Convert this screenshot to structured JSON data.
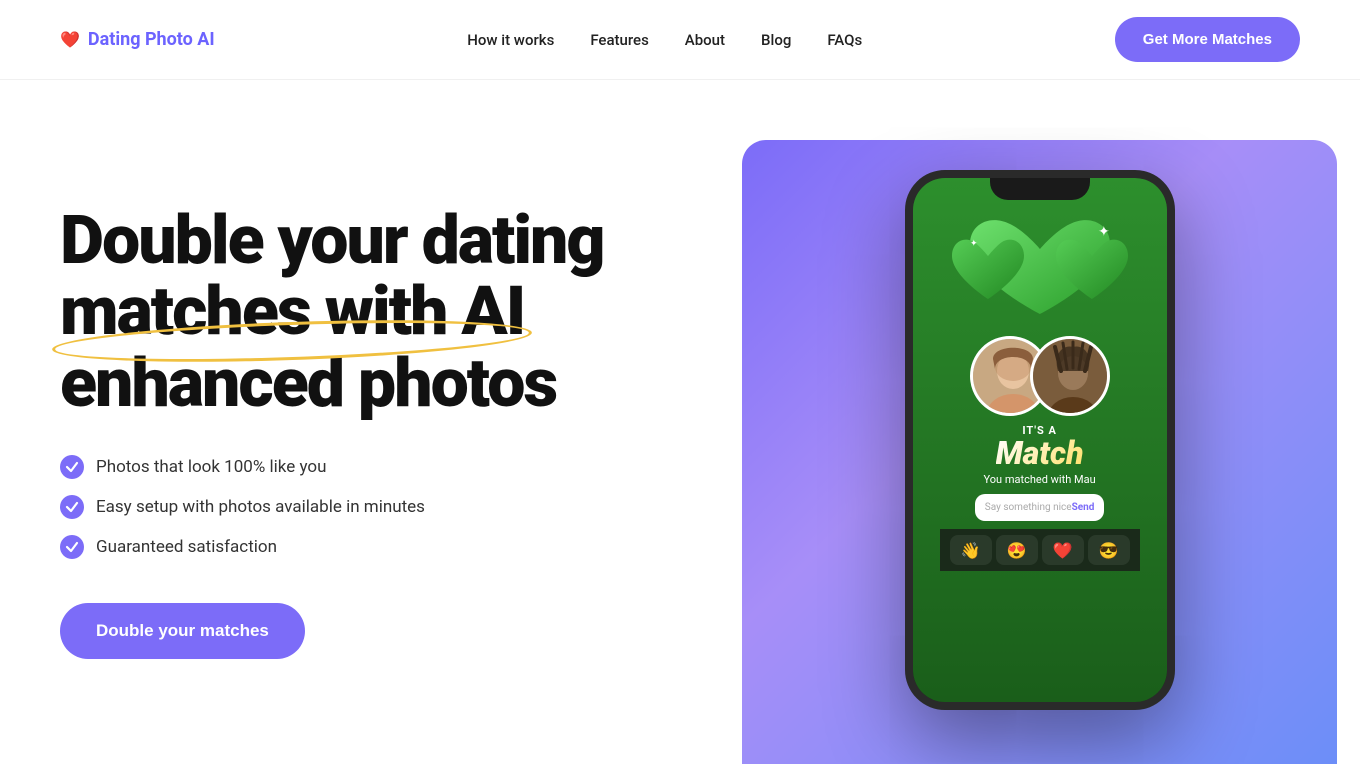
{
  "brand": {
    "name": "Dating Photo AI",
    "logo_icon": "❤️"
  },
  "nav": {
    "links": [
      {
        "id": "how-it-works",
        "label": "How it works"
      },
      {
        "id": "features",
        "label": "Features"
      },
      {
        "id": "about",
        "label": "About"
      },
      {
        "id": "blog",
        "label": "Blog"
      },
      {
        "id": "faqs",
        "label": "FAQs"
      }
    ],
    "cta_label": "Get More Matches"
  },
  "hero": {
    "title_line1": "Double your dating",
    "title_line2_underline": "matches",
    "title_line2_rest": " with AI",
    "title_line3": "enhanced photos",
    "checks": [
      {
        "id": "check1",
        "text": "Photos that look 100% like you"
      },
      {
        "id": "check2",
        "text": "Easy setup with photos available in minutes"
      },
      {
        "id": "check3",
        "text": "Guaranteed satisfaction"
      }
    ],
    "cta_label": "Double your matches"
  },
  "phone": {
    "its_a": "IT'S A",
    "match": "Match",
    "matched_with": "You matched with Mau",
    "message_placeholder": "Say something nice",
    "send_label": "Send",
    "emojis": [
      "👋",
      "😍",
      "❤️",
      "😎"
    ]
  }
}
